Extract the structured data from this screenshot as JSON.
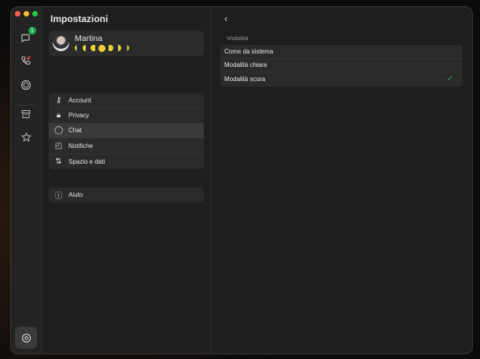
{
  "rail": {
    "chats_badge": "1",
    "colors": {
      "close": "#fe5f57",
      "minimize": "#febc2e",
      "maximize": "#28c840",
      "badge": "#1fa855"
    }
  },
  "settings": {
    "title": "Impostazioni",
    "profile": {
      "name": "Martina",
      "status_moons": [
        "waning-crescent",
        "last-quarter",
        "waning-gibbous",
        "full",
        "waxing-gibbous",
        "first-quarter",
        "waxing-crescent"
      ]
    },
    "items": [
      {
        "label": "Account",
        "icon": "key-icon"
      },
      {
        "label": "Privacy",
        "icon": "lock-icon"
      },
      {
        "label": "Chat",
        "icon": "chat-bubble-icon",
        "active": true
      },
      {
        "label": "Notifiche",
        "icon": "notification-icon"
      },
      {
        "label": "Spazio e dati",
        "icon": "arrows-updown-icon"
      }
    ],
    "help": {
      "label": "Aiuto",
      "icon": "info-icon"
    }
  },
  "detail": {
    "section": "Visibilità",
    "options": [
      {
        "label": "Come da sistema",
        "selected": false
      },
      {
        "label": "Modalità chiara",
        "selected": false
      },
      {
        "label": "Modalità scura",
        "selected": true
      }
    ]
  }
}
